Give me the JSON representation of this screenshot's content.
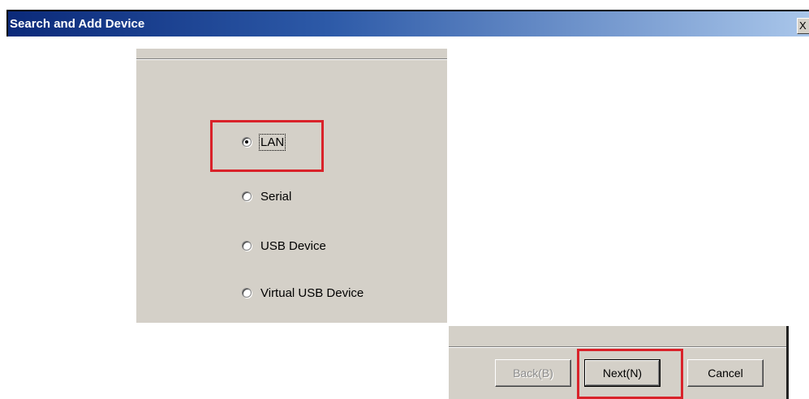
{
  "window": {
    "title": "Search and Add Device",
    "close_glyph": "X"
  },
  "connection_options": [
    {
      "label": "LAN",
      "selected": true
    },
    {
      "label": "Serial",
      "selected": false
    },
    {
      "label": "USB Device",
      "selected": false
    },
    {
      "label": "Virtual USB Device",
      "selected": false
    }
  ],
  "buttons": {
    "back": "Back(B)",
    "next": "Next(N)",
    "cancel": "Cancel"
  },
  "highlight_color": "#d9222a",
  "icons": [
    "close-icon",
    "radio-selected-icon",
    "radio-unselected-icon"
  ]
}
